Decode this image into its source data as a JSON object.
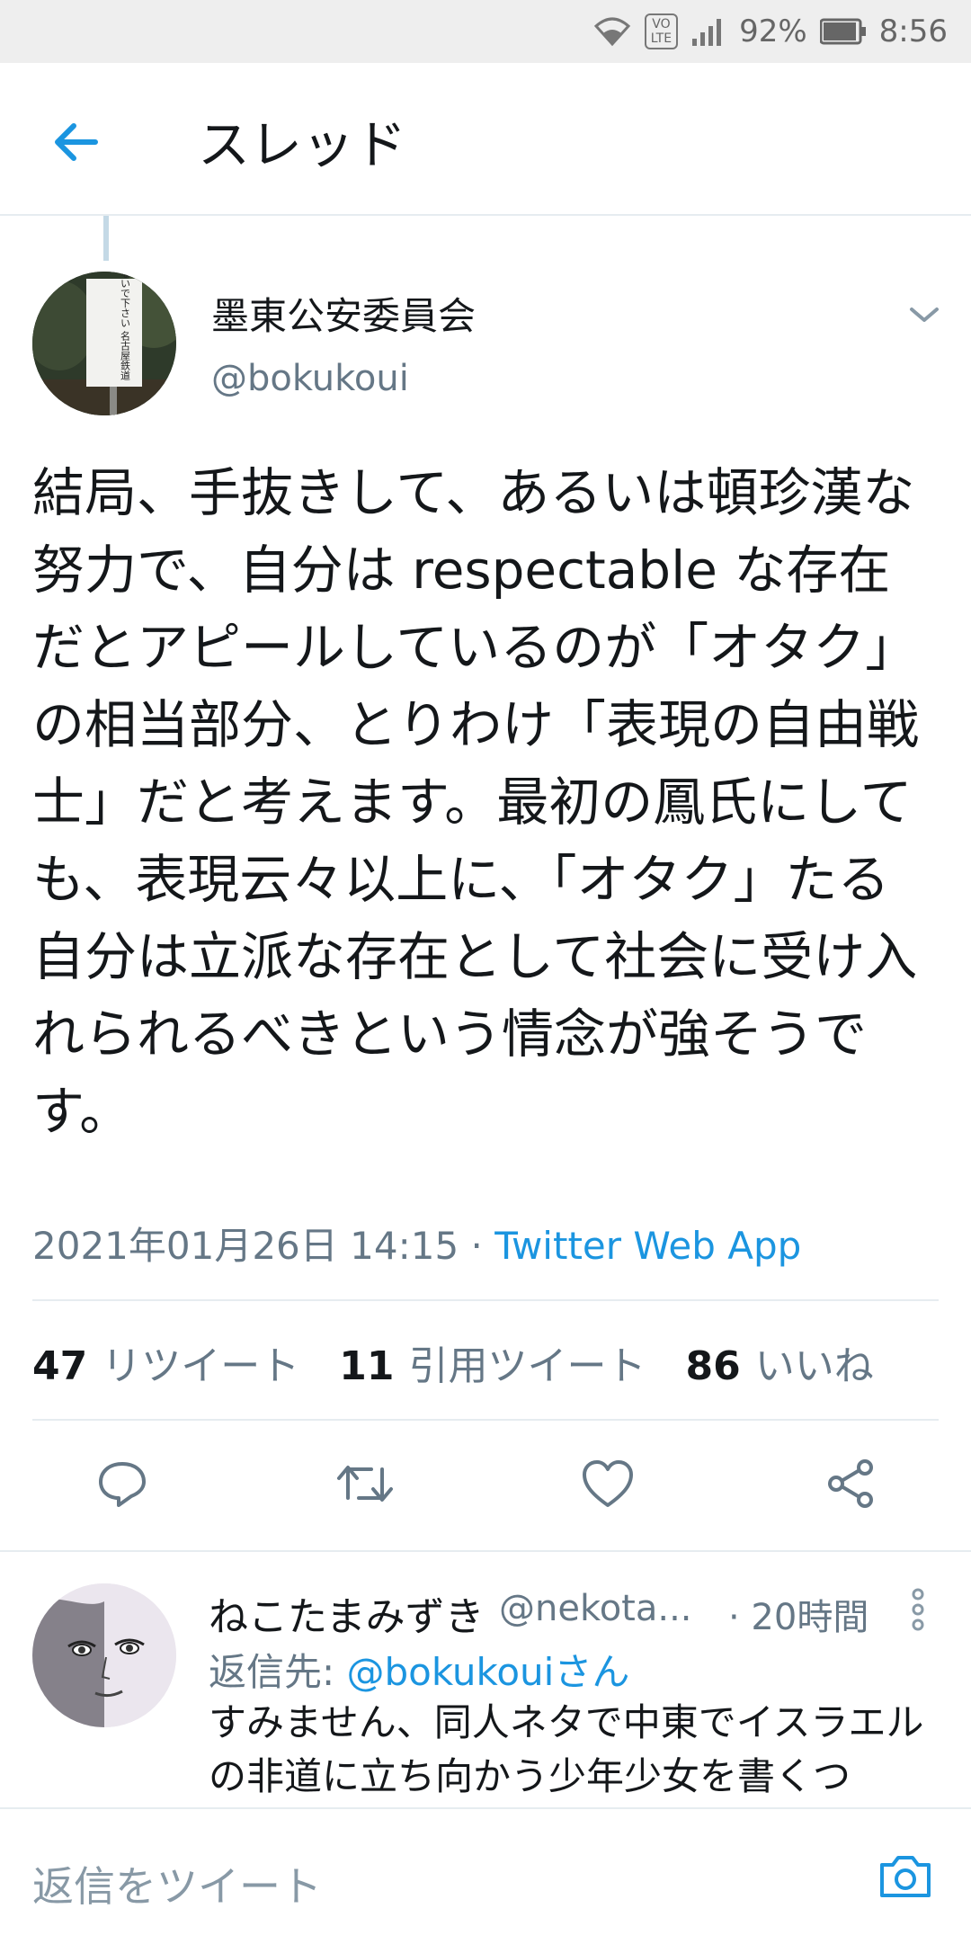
{
  "status_bar": {
    "lte_top": "VO",
    "lte_bottom": "LTE",
    "battery": "92%",
    "time": "8:56"
  },
  "header": {
    "title": "スレッド"
  },
  "tweet": {
    "author_name": "墨東公安委員会",
    "author_handle": "@bokukoui",
    "avatar_sign_text": "線路内を耕作しないで下さい 名古屋鉄道",
    "text": "結局、手抜きして、あるいは頓珍漢な努力で、自分は respectable な存在だとアピールしているのが「オタク」の相当部分、とりわけ「表現の自由戦士」だと考えます。最初の鳳氏にしても、表現云々以上に、「オタク」たる自分は立派な存在として社会に受け入れられるべきという情念が強そうです。",
    "timestamp": "2021年01月26日 14:15",
    "separator": "·",
    "source_app": "Twitter Web App",
    "stats": {
      "retweets_count": "47",
      "retweets_label": "リツイート",
      "quotes_count": "11",
      "quotes_label": "引用ツイート",
      "likes_count": "86",
      "likes_label": "いいね"
    }
  },
  "reply": {
    "author_name": "ねこたまみずき",
    "author_handle": "@nekota...",
    "time": "· 20時間",
    "reply_to_prefix": "返信先: ",
    "reply_to_handle": "@bokukouiさん",
    "text": "すみません、同人ネタで中東でイスラエルの非道に立ち向かう少年少女を書くつ"
  },
  "compose": {
    "placeholder": "返信をツイート"
  },
  "colors": {
    "accent": "#1b95e0",
    "secondary_text": "#657786",
    "divider": "#e6ecf0"
  }
}
